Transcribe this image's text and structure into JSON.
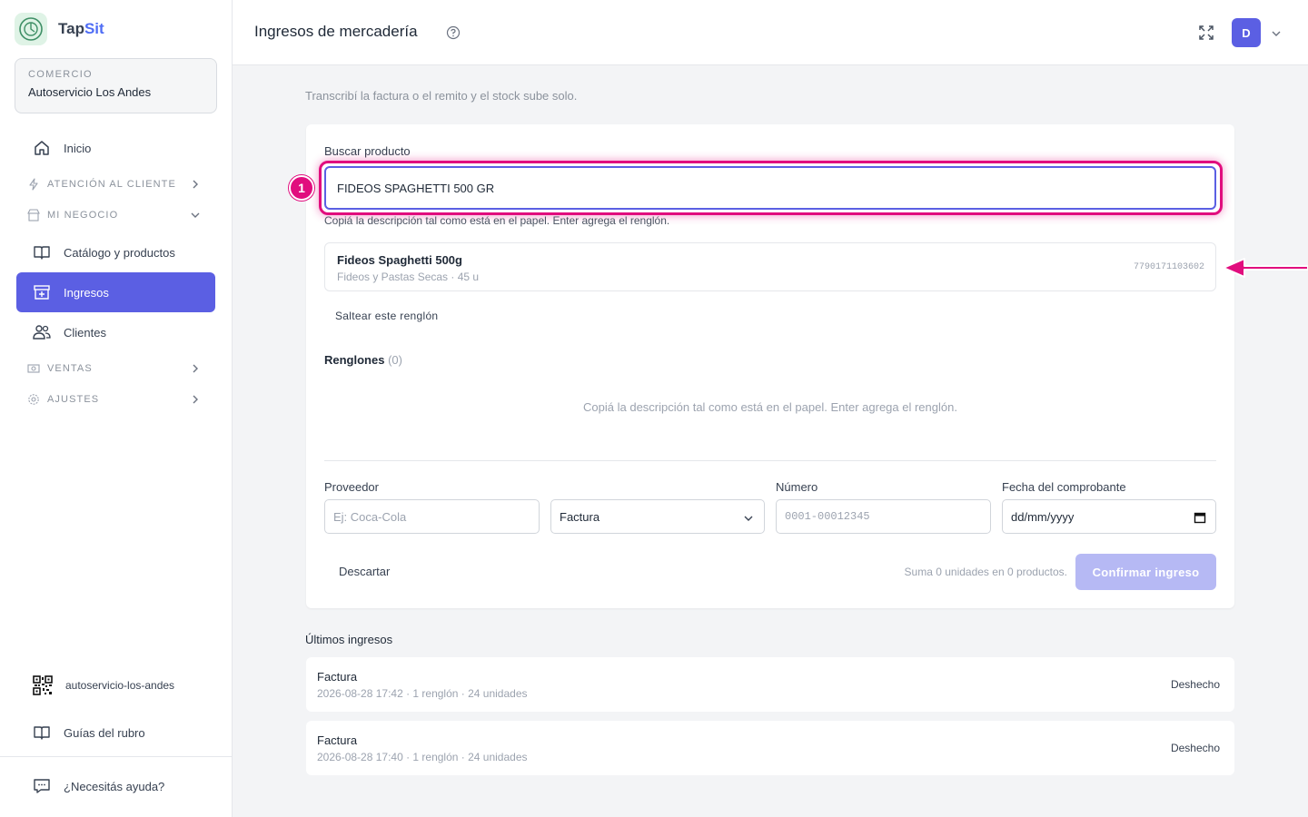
{
  "brand": {
    "name_prefix": "Tap",
    "name_suffix": "Sit"
  },
  "store": {
    "label": "COMERCIO",
    "name": "Autoservicio Los Andes"
  },
  "nav": {
    "home": "Inicio",
    "customer_service": "ATENCIÓN AL CLIENTE",
    "my_business": "MI NEGOCIO",
    "catalog": "Catálogo y productos",
    "intake": "Ingresos",
    "clients": "Clientes",
    "sales": "VENTAS",
    "settings": "AJUSTES"
  },
  "sidebar_footer": {
    "slug": "autoservicio-los-andes",
    "guides": "Guías del rubro",
    "help": "¿Necesitás ayuda?"
  },
  "header": {
    "title": "Ingresos de mercadería",
    "avatar_initial": "D"
  },
  "page": {
    "subtitle": "Transcribí la factura o el remito y el stock sube solo."
  },
  "search": {
    "label": "Buscar producto",
    "value": "FIDEOS SPAGHETTI 500 GR",
    "hint": "Copiá la descripción tal como está en el papel. Enter agrega el renglón.",
    "step_number": "1"
  },
  "result": {
    "name": "Fideos Spaghetti 500g",
    "meta": "Fideos y Pastas Secas · 45 u",
    "code": "7790171103602"
  },
  "skip_label": "Saltear este renglón",
  "lines": {
    "title": "Renglones",
    "count": "(0)",
    "empty": "Copiá la descripción tal como está en el papel. Enter agrega el renglón."
  },
  "form": {
    "supplier_label": "Proveedor",
    "supplier_placeholder": "Ej: Coca-Cola",
    "doc_type": "Factura",
    "number_label": "Número",
    "number_placeholder": "0001-00012345",
    "date_label": "Fecha del comprobante",
    "date_placeholder": "dd/mm/yyyy"
  },
  "actions": {
    "discard": "Descartar",
    "summary": "Suma 0 unidades en 0 productos.",
    "confirm": "Confirmar ingreso"
  },
  "last": {
    "title": "Últimos ingresos",
    "entries": [
      {
        "type": "Factura",
        "meta": "2026-08-28 17:42 · 1 renglón · 24 unidades",
        "action": "Deshecho"
      },
      {
        "type": "Factura",
        "meta": "2026-08-28 17:40 · 1 renglón · 24 unidades",
        "action": "Deshecho"
      }
    ]
  },
  "colors": {
    "accent": "#5b5fe3",
    "highlight": "#e10d7e",
    "confirm_disabled": "#b6b9f4"
  }
}
